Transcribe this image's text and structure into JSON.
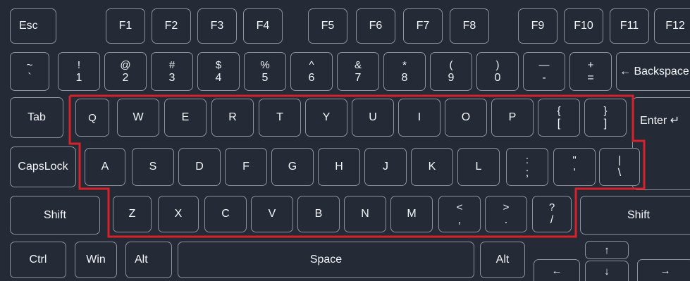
{
  "keyboard": {
    "row_fn": {
      "esc": "Esc",
      "f1": "F1",
      "f2": "F2",
      "f3": "F3",
      "f4": "F4",
      "f5": "F5",
      "f6": "F6",
      "f7": "F7",
      "f8": "F8",
      "f9": "F9",
      "f10": "F10",
      "f11": "F11",
      "f12": "F12"
    },
    "row_num": {
      "tilde": {
        "top": "~",
        "bottom": "`"
      },
      "k1": {
        "top": "!",
        "bottom": "1"
      },
      "k2": {
        "top": "@",
        "bottom": "2"
      },
      "k3": {
        "top": "#",
        "bottom": "3"
      },
      "k4": {
        "top": "$",
        "bottom": "4"
      },
      "k5": {
        "top": "%",
        "bottom": "5"
      },
      "k6": {
        "top": "^",
        "bottom": "6"
      },
      "k7": {
        "top": "&",
        "bottom": "7"
      },
      "k8": {
        "top": "*",
        "bottom": "8"
      },
      "k9": {
        "top": "(",
        "bottom": "9"
      },
      "k0": {
        "top": ")",
        "bottom": "0"
      },
      "minus": {
        "top": "—",
        "bottom": "-"
      },
      "equals": {
        "top": "+",
        "bottom": "="
      },
      "backspace": "← Backspace"
    },
    "row_q": {
      "tab": "Tab",
      "q": "Q",
      "w": "W",
      "e": "E",
      "r": "R",
      "t": "T",
      "y": "Y",
      "u": "U",
      "i": "I",
      "o": "O",
      "p": "P",
      "lbracket": {
        "top": "{",
        "bottom": "["
      },
      "rbracket": {
        "top": "}",
        "bottom": "]"
      },
      "enter": "Enter ↵"
    },
    "row_a": {
      "capslock": "CapsLock",
      "a": "A",
      "s": "S",
      "d": "D",
      "f": "F",
      "g": "G",
      "h": "H",
      "j": "J",
      "k": "K",
      "l": "L",
      "semicolon": {
        "top": ":",
        "bottom": ";"
      },
      "quote": {
        "top": "\"",
        "bottom": "'"
      },
      "backslash": {
        "top": "|",
        "bottom": "\\"
      }
    },
    "row_z": {
      "lshift": "Shift",
      "z": "Z",
      "x": "X",
      "c": "C",
      "v": "V",
      "b": "B",
      "n": "N",
      "m": "M",
      "comma": {
        "top": "<",
        "bottom": ","
      },
      "period": {
        "top": ">",
        "bottom": "."
      },
      "slash": {
        "top": "?",
        "bottom": "/"
      },
      "rshift": "Shift"
    },
    "row_bottom": {
      "ctrl": "Ctrl",
      "win": "Win",
      "lalt": "Alt",
      "space": "Space",
      "ralt": "Alt",
      "up": "↑",
      "left": "←",
      "down": "↓",
      "right": "→"
    }
  },
  "highlight_color": "#d7222b",
  "key_border_color": "#8c939e",
  "background_color": "#252b36"
}
